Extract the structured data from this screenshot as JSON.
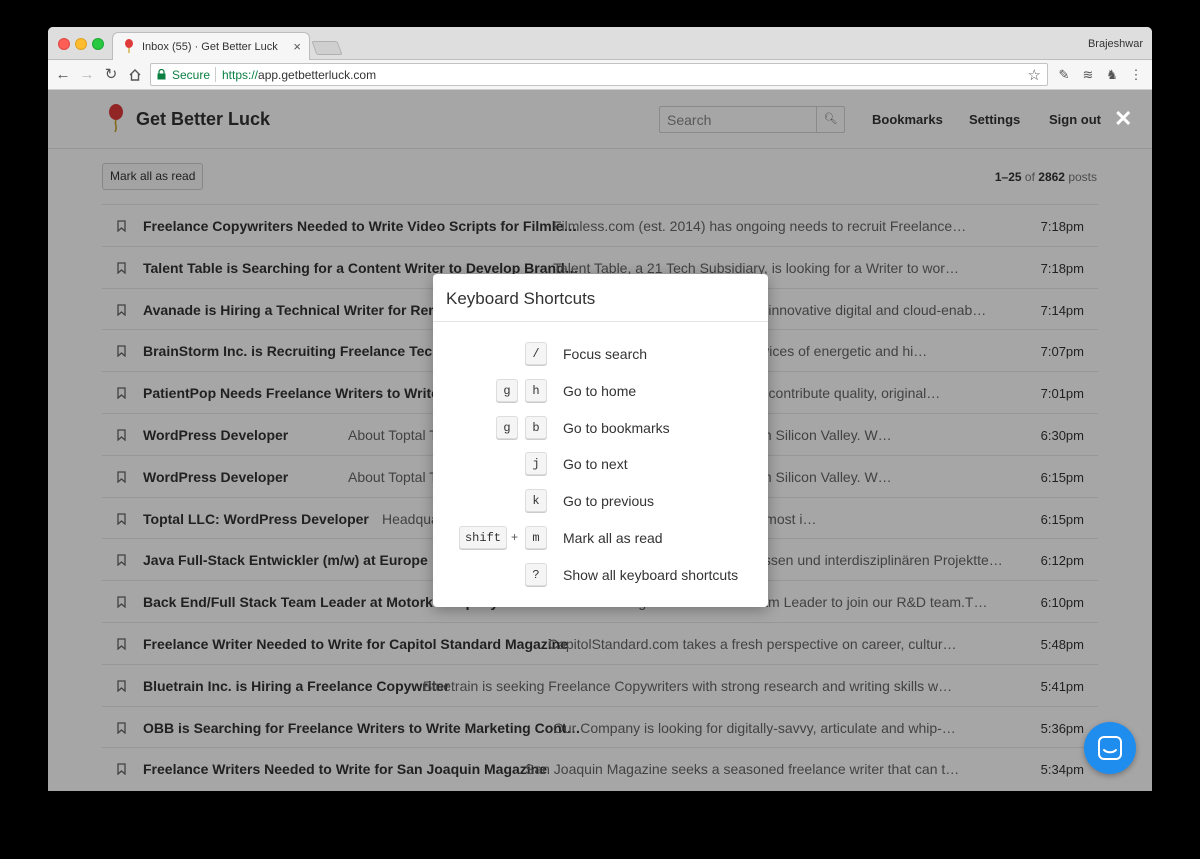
{
  "browser": {
    "tab_title": "Inbox (55) · Get Better Luck",
    "tab_close": "×",
    "profile_name": "Brajeshwar",
    "secure_label": "Secure",
    "url_scheme": "https://",
    "url_host": "app.getbetterluck.com"
  },
  "header": {
    "logo_text": "Get Better Luck",
    "search_placeholder": "Search",
    "bookmarks": "Bookmarks",
    "settings": "Settings",
    "sign_out": "Sign out",
    "close": "✕"
  },
  "toolbar": {
    "mark_all": "Mark all as read",
    "range": "1–25",
    "of": "of",
    "total": "2862",
    "unit": "posts"
  },
  "posts": [
    {
      "title": "Freelance Copywriters Needed to Write Video Scripts for Filmle…",
      "excerpt": "Filmless.com (est. 2014) has ongoing needs to recruit Freelance…",
      "time": "7:18pm"
    },
    {
      "title": "Talent Table is Searching for a Content Writer to Develop Brand…",
      "excerpt": "Talent Table, a 21 Tech Subsidiary, is looking for a Writer to wor…",
      "time": "7:18pm"
    },
    {
      "title": "Avanade is Hiring a Technical Writer for Remote Work",
      "excerpt": "Avanade is the leading provider of innovative digital and cloud-enab…",
      "time": "7:14pm"
    },
    {
      "title": "BrainStorm Inc. is Recruiting Freelance Technical Writers",
      "excerpt": "BrainStorm Inc. is seeking the services of energetic and hi…",
      "time": "7:07pm"
    },
    {
      "title": "PatientPop Needs Freelance Writers to Write Healthcare",
      "excerpt": "PatientPop is looking for writers to contribute quality, original…",
      "time": "7:01pm"
    },
    {
      "title": "WordPress Developer",
      "excerpt": "About Toptal Toptal is one of the most in-demand tech start-ups from Silicon Valley. W…",
      "time": "6:30pm"
    },
    {
      "title": "WordPress Developer",
      "excerpt": "About Toptal Toptal is one of the most in-demand tech start-ups from Silicon Valley. W…",
      "time": "6:15pm"
    },
    {
      "title": "Toptal LLC: WordPress Developer",
      "excerpt": "Headquarters: Remote URL: About Toptal Toptal is one of the most i…",
      "time": "6:15pm"
    },
    {
      "title": "Java Full-Stack Entwickler (m/w) at Europe",
      "excerpt": "Wir suchen Verstärkung mit Interessen und interdisziplinären Projektte…",
      "time": "6:12pm"
    },
    {
      "title": "Back End/Full Stack Team Leader at Motork company",
      "excerpt": "We are looking for a Back End Team Leader to join our R&D team.T…",
      "time": "6:10pm"
    },
    {
      "title": "Freelance Writer Needed to Write for Capitol Standard Magazine",
      "excerpt": "CapitolStandard.com takes a fresh perspective on career, cultur…",
      "time": "5:48pm"
    },
    {
      "title": "Bluetrain Inc. is Hiring a Freelance Copywriter",
      "excerpt": "Bluetrain is seeking Freelance Copywriters with strong research and writing skills w…",
      "time": "5:41pm"
    },
    {
      "title": "OBB is Searching for Freelance Writers to Write Marketing Cont…",
      "excerpt": "Our Company is looking for digitally-savvy, articulate and whip-…",
      "time": "5:36pm"
    },
    {
      "title": "Freelance Writers Needed to Write for San Joaquin Magazine",
      "excerpt": "San Joaquin Magazine seeks a seasoned freelance writer that can t…",
      "time": "5:34pm"
    }
  ],
  "modal": {
    "title": "Keyboard Shortcuts",
    "shortcuts": [
      {
        "keys": [
          "/"
        ],
        "plus": "",
        "desc": "Focus search"
      },
      {
        "keys": [
          "g",
          "h"
        ],
        "plus": "",
        "desc": "Go to home"
      },
      {
        "keys": [
          "g",
          "b"
        ],
        "plus": "",
        "desc": "Go to bookmarks"
      },
      {
        "keys": [
          "j"
        ],
        "plus": "",
        "desc": "Go to next"
      },
      {
        "keys": [
          "k"
        ],
        "plus": "",
        "desc": "Go to previous"
      },
      {
        "keys": [
          "shift",
          "m"
        ],
        "plus": "+",
        "desc": "Mark all as read"
      },
      {
        "keys": [
          "?"
        ],
        "plus": "",
        "desc": "Show all keyboard shortcuts"
      }
    ]
  },
  "colors": {
    "secure_green": "#0b8043",
    "chat_blue": "#1f8ded",
    "logo_red": "#e03b3b"
  }
}
